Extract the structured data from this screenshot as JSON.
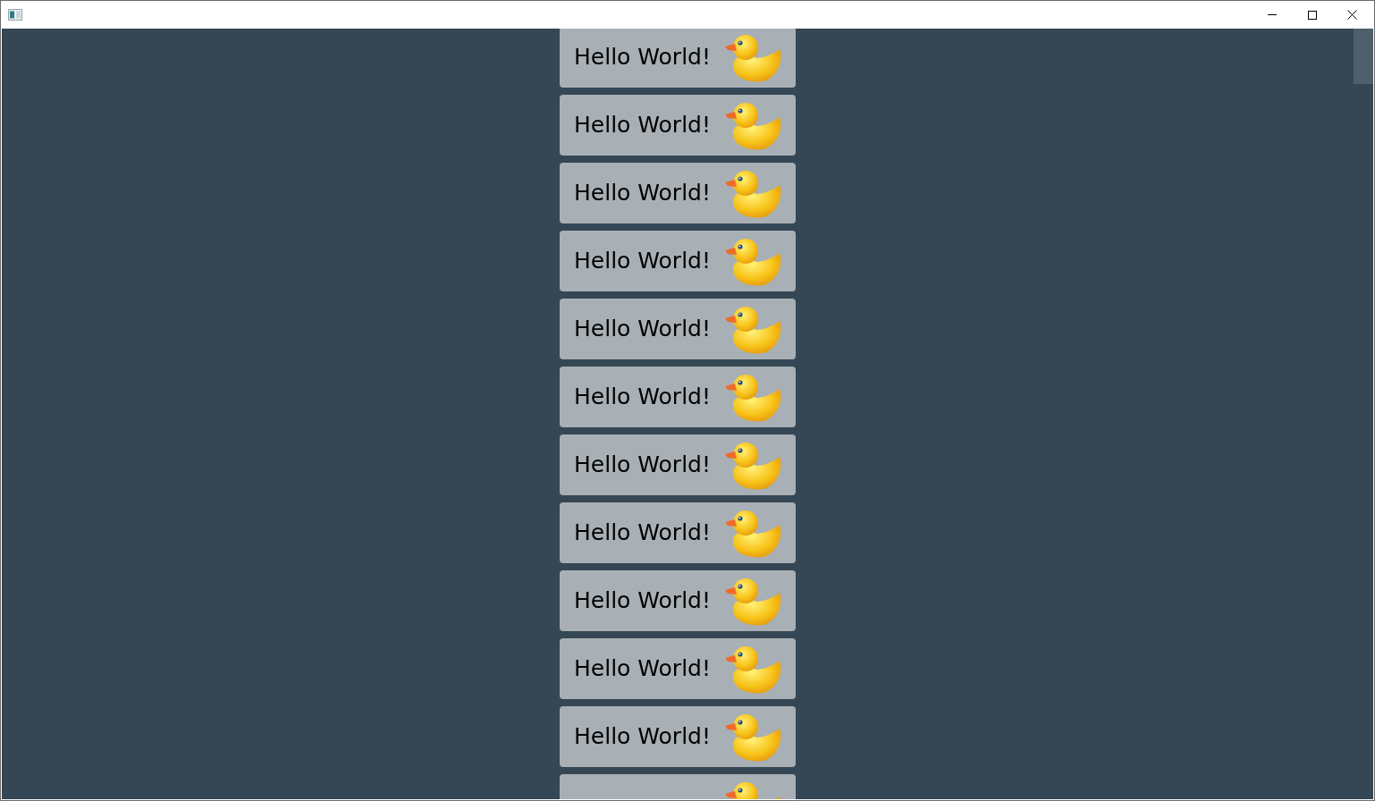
{
  "items": [
    {
      "kind": "card",
      "label": "Hello World!"
    },
    {
      "kind": "card",
      "label": "Hello World!"
    },
    {
      "kind": "card",
      "label": "Hello World!"
    },
    {
      "kind": "card",
      "label": "Hello World!"
    },
    {
      "kind": "card",
      "label": "Hello World!"
    },
    {
      "kind": "card",
      "label": "Hello World!"
    },
    {
      "kind": "card",
      "label": "Hello World!"
    },
    {
      "kind": "card",
      "label": "Hello World!"
    },
    {
      "kind": "card",
      "label": "Hello World!"
    },
    {
      "kind": "card",
      "label": "Hello World!"
    },
    {
      "kind": "card",
      "label": "Hello World!"
    },
    {
      "kind": "partial"
    }
  ]
}
